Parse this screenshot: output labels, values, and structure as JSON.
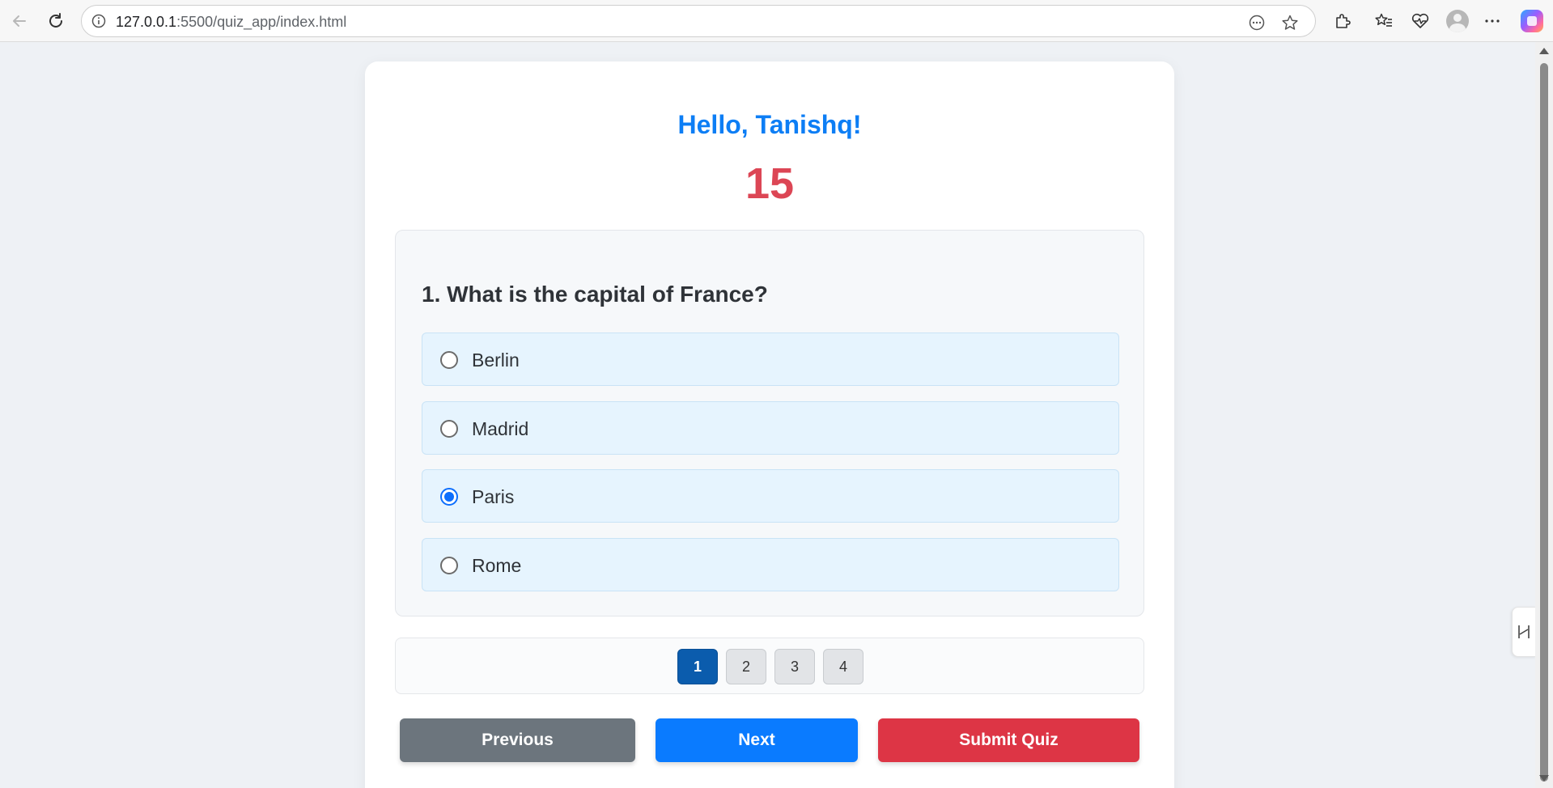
{
  "browser": {
    "url_host": "127.0.0.1",
    "url_path": ":5500/quiz_app/index.html"
  },
  "quiz": {
    "greeting": "Hello, Tanishq!",
    "timer": "15",
    "question": "1. What is the capital of France?",
    "options": [
      "Berlin",
      "Madrid",
      "Paris",
      "Rome"
    ],
    "selected_option": "Paris",
    "pages": [
      "1",
      "2",
      "3",
      "4"
    ],
    "active_page": "1",
    "prev_label": "Previous",
    "next_label": "Next",
    "submit_label": "Submit Quiz"
  },
  "colors": {
    "greeting": "#0d7ef5",
    "timer": "#dc4655",
    "prev_button": "#6c757d",
    "next_button": "#0a7bff",
    "submit_button": "#dd3545",
    "active_page": "#0b5cad"
  }
}
